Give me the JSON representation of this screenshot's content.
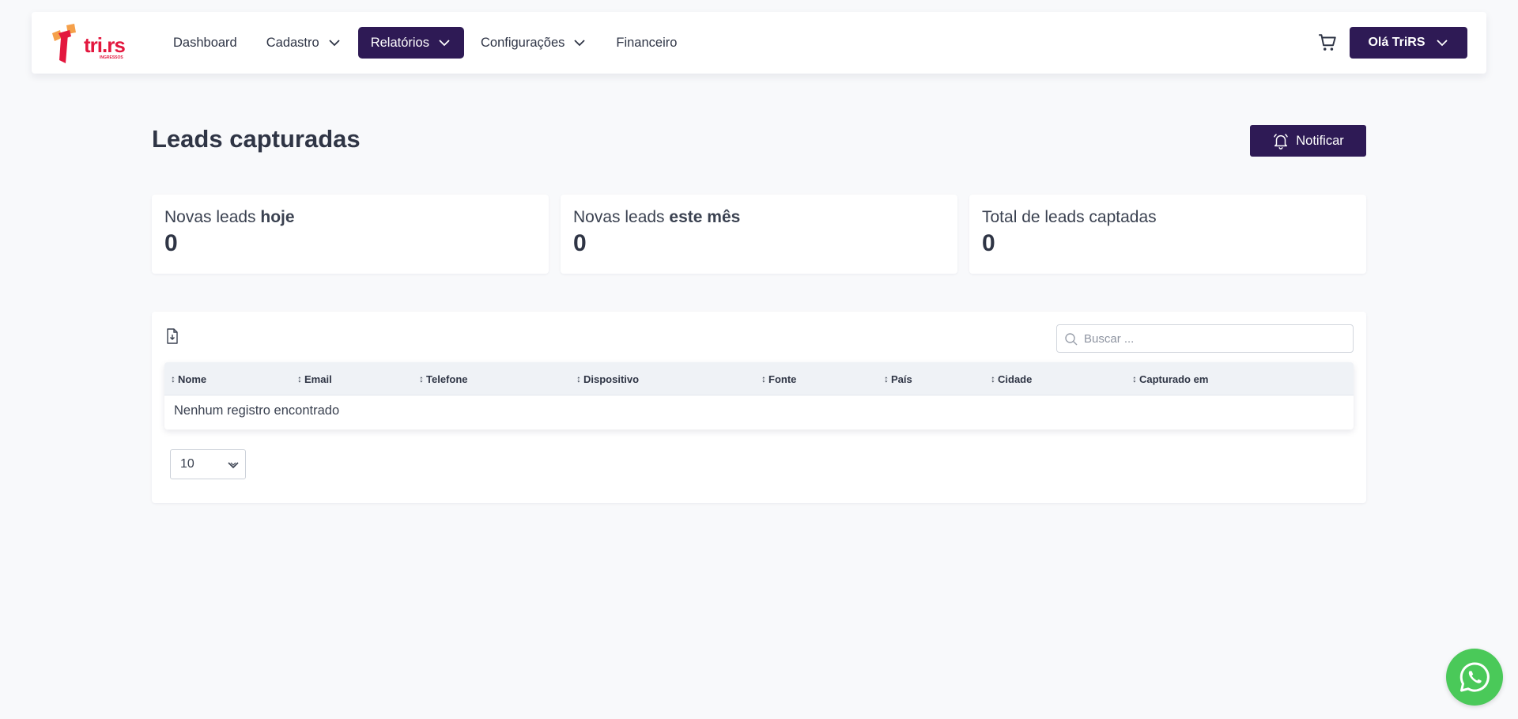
{
  "brand": {
    "logo_text": "tri.rs",
    "logo_subtext": "INGRESSOS",
    "accent_color": "#2e1a55",
    "logo_red": "#e3173e",
    "logo_orange": "#f5a04a"
  },
  "nav": {
    "items": [
      {
        "label": "Dashboard",
        "has_dropdown": false,
        "active": false
      },
      {
        "label": "Cadastro",
        "has_dropdown": true,
        "active": false
      },
      {
        "label": "Relatórios",
        "has_dropdown": true,
        "active": true
      },
      {
        "label": "Configurações",
        "has_dropdown": true,
        "active": false
      },
      {
        "label": "Financeiro",
        "has_dropdown": false,
        "active": false
      }
    ],
    "cart_icon": "cart-icon",
    "user_label": "Olá TriRS"
  },
  "page": {
    "title": "Leads capturadas",
    "notify_label": "Notificar"
  },
  "stats": [
    {
      "label_prefix": "Novas leads ",
      "label_bold": "hoje",
      "value": "0"
    },
    {
      "label_prefix": "Novas leads ",
      "label_bold": "este mês",
      "value": "0"
    },
    {
      "label_prefix": "Total de leads captadas",
      "label_bold": "",
      "value": "0"
    }
  ],
  "table": {
    "search_placeholder": "Buscar ...",
    "columns": [
      "Nome",
      "Email",
      "Telefone",
      "Dispositivo",
      "Fonte",
      "País",
      "Cidade",
      "Capturado em"
    ],
    "sort_glyph": "↕",
    "empty_message": "Nenhum registro encontrado",
    "page_size": "10"
  },
  "whatsapp_color": "#4ac959"
}
